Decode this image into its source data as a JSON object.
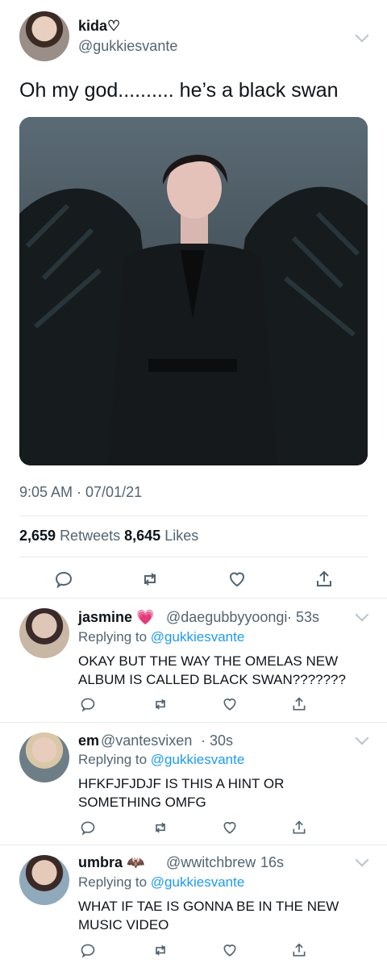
{
  "tweet": {
    "display_name": "kida♡",
    "handle": "@gukkiesvante",
    "text": "Oh my god.......... he’s a black swan",
    "timestamp": "9:05 AM · 07/01/21",
    "retweets_count": "2,659",
    "retweets_label": "Retweets",
    "likes_count": "8,645",
    "likes_label": "Likes"
  },
  "actions": [
    "reply-icon",
    "retweet-icon",
    "like-icon",
    "share-icon"
  ],
  "replies": [
    {
      "name": "jasmine 💗",
      "handle": "@daegubbyyoongi",
      "time": "· 53s",
      "replying_label": "Replying to",
      "replying_to": "@gukkiesvante",
      "text": "OKAY BUT THE WAY THE OMELAS NEW ALBUM IS CALLED BLACK SWAN???????"
    },
    {
      "name": "em",
      "handle": "@vantesvixen",
      "time": "· 30s",
      "replying_label": "Replying to",
      "replying_to": "@gukkiesvante",
      "text": "HFKFJFJDJF IS THIS A HINT OR SOMETHING OMFG"
    },
    {
      "name": "umbra 🦇",
      "handle": "@wwitchbrew",
      "time": "· 16s",
      "replying_label": "Replying to",
      "replying_to": "@gukkiesvante",
      "text": "WHAT IF TAE IS GONNA BE IN THE NEW MUSIC VIDEO"
    }
  ],
  "colors": {
    "accent": "#1d9bf0",
    "muted": "#536471",
    "text": "#0f1419",
    "divider": "#e6ecf0"
  }
}
